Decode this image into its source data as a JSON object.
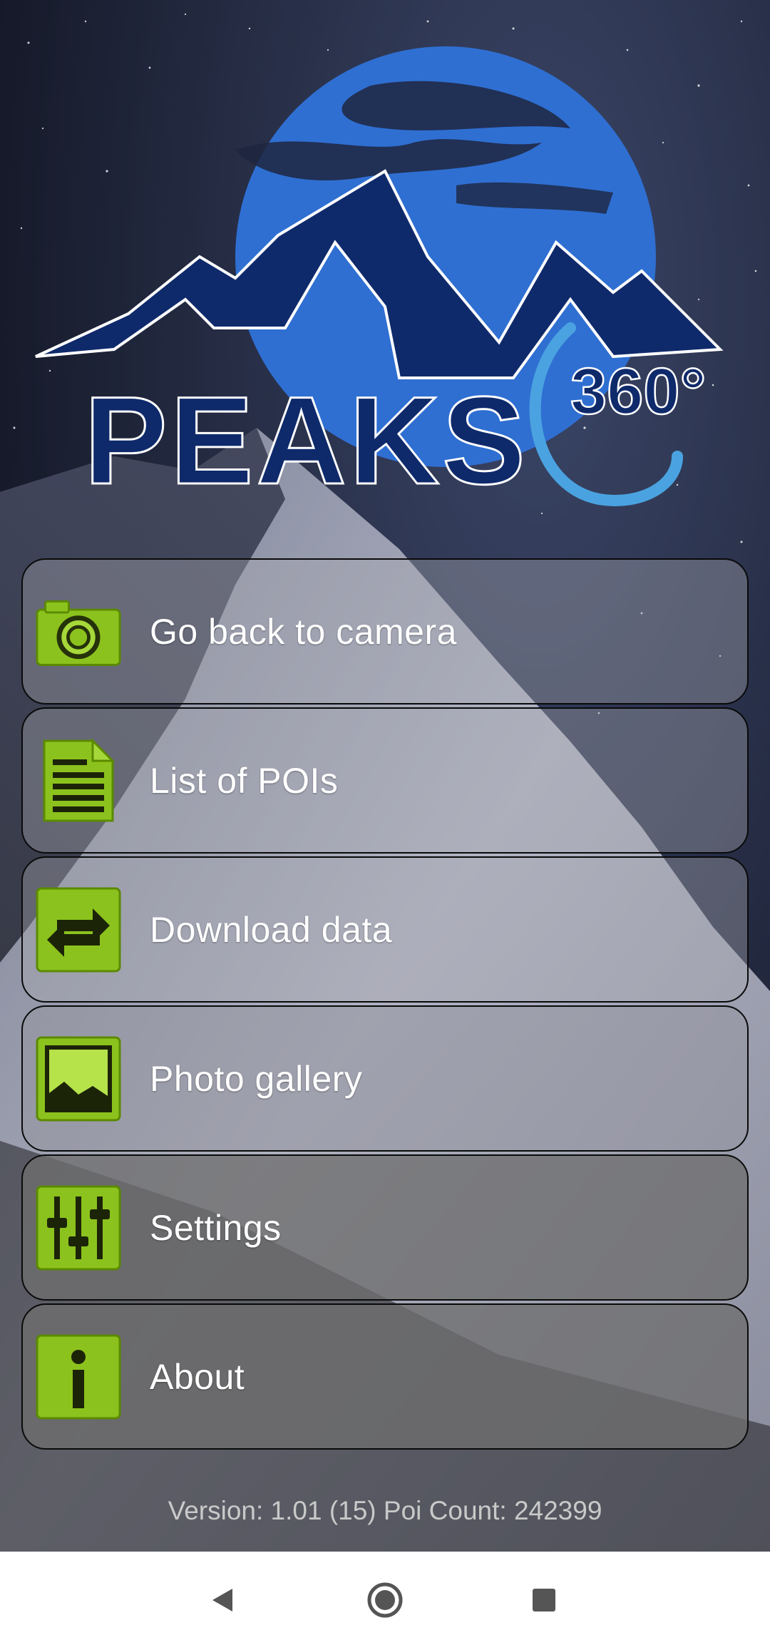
{
  "logo": {
    "word": "PEAKS",
    "degrees": "360°"
  },
  "menu": {
    "items": [
      {
        "label": "Go back to camera",
        "icon": "camera-icon"
      },
      {
        "label": "List of POIs",
        "icon": "document-icon"
      },
      {
        "label": "Download data",
        "icon": "transfer-arrows-icon"
      },
      {
        "label": "Photo gallery",
        "icon": "picture-icon"
      },
      {
        "label": "Settings",
        "icon": "sliders-icon"
      },
      {
        "label": "About",
        "icon": "info-icon"
      }
    ]
  },
  "footer": {
    "version_text": "Version: 1.01 (15) Poi Count: 242399"
  },
  "navbar": {
    "back": "back-icon",
    "home": "home-icon",
    "recents": "recents-icon"
  },
  "colors": {
    "logo_blue": "#2f6fd2",
    "logo_navy": "#0f2a6b",
    "icon_green": "#8cc21d",
    "menu_text": "#ffffff"
  }
}
